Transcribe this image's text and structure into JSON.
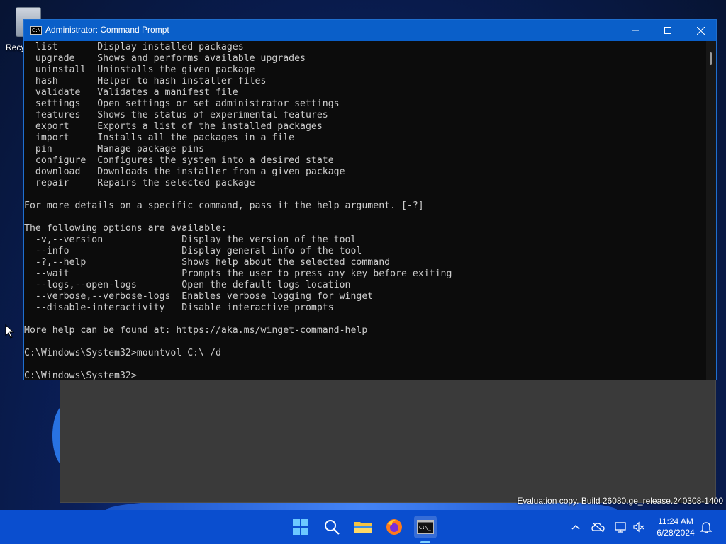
{
  "desktop": {
    "recycle_bin_label": "Recy",
    "watermark": "Evaluation copy. Build 26080.ge_release.240308-1400"
  },
  "window": {
    "title": "Administrator: Command Prompt",
    "icon_text": "C:\\_"
  },
  "console": {
    "lines": [
      "  list       Display installed packages",
      "  upgrade    Shows and performs available upgrades",
      "  uninstall  Uninstalls the given package",
      "  hash       Helper to hash installer files",
      "  validate   Validates a manifest file",
      "  settings   Open settings or set administrator settings",
      "  features   Shows the status of experimental features",
      "  export     Exports a list of the installed packages",
      "  import     Installs all the packages in a file",
      "  pin        Manage package pins",
      "  configure  Configures the system into a desired state",
      "  download   Downloads the installer from a given package",
      "  repair     Repairs the selected package",
      "",
      "For more details on a specific command, pass it the help argument. [-?]",
      "",
      "The following options are available:",
      "  -v,--version              Display the version of the tool",
      "  --info                    Display general info of the tool",
      "  -?,--help                 Shows help about the selected command",
      "  --wait                    Prompts the user to press any key before exiting",
      "  --logs,--open-logs        Open the default logs location",
      "  --verbose,--verbose-logs  Enables verbose logging for winget",
      "  --disable-interactivity   Disable interactive prompts",
      "",
      "More help can be found at: https://aka.ms/winget-command-help",
      "",
      "C:\\Windows\\System32>mountvol C:\\ /d",
      "",
      "C:\\Windows\\System32>"
    ]
  },
  "taskbar": {
    "items": [
      "start-icon",
      "search-icon",
      "file-explorer-icon",
      "firefox-icon",
      "command-prompt-icon"
    ],
    "clock_time": "11:24 AM",
    "clock_date": "6/28/2024",
    "accent": "#0a4ecf"
  },
  "colors": {
    "titlebar": "#0a5fc9",
    "console_bg": "#0c0c0c",
    "console_text": "#cccccc"
  }
}
